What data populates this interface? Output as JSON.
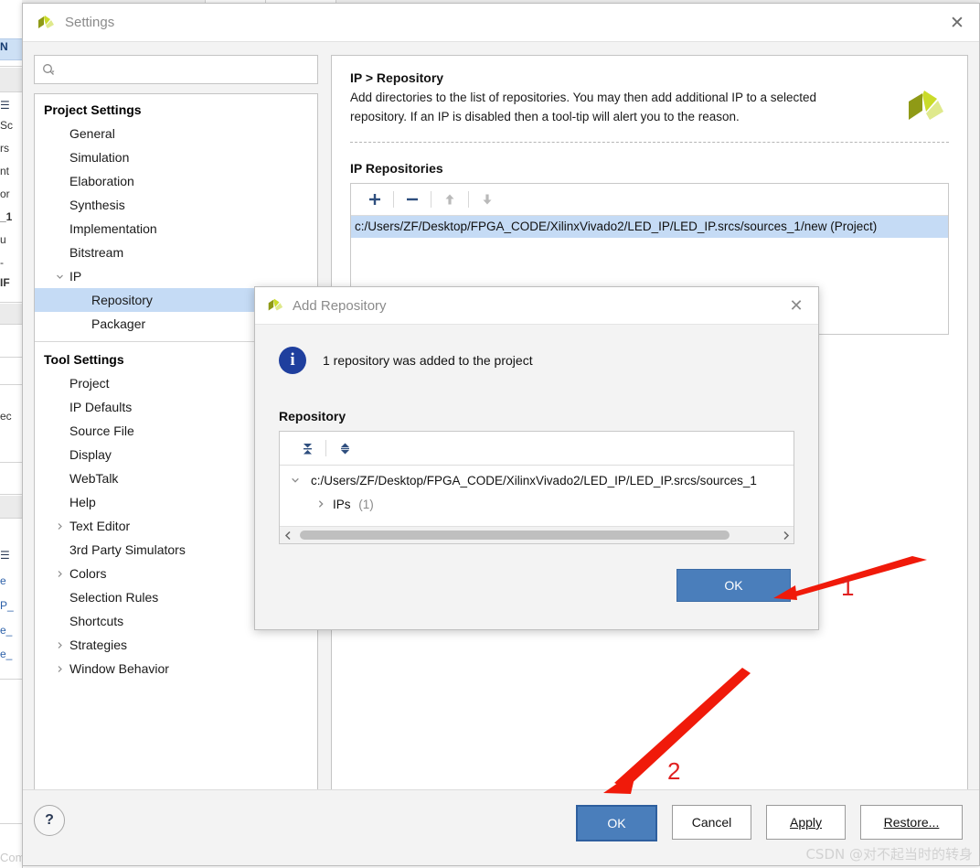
{
  "background": {
    "left_strip_labels": [
      "N",
      "Sc",
      "rs",
      "nt",
      "or",
      "_1",
      "u",
      "-",
      "IF",
      "ec",
      "e",
      "P_",
      "e_",
      "e_"
    ],
    "bottom_text": "Command here"
  },
  "window": {
    "title": "Settings",
    "close_icon": "close-icon",
    "logo_icon": "vivado-logo-icon"
  },
  "search": {
    "value": "",
    "placeholder": "",
    "icon": "search-icon"
  },
  "sidebar": {
    "groups": [
      {
        "label": "Project Settings",
        "items": [
          {
            "label": "General",
            "expandable": false,
            "selected": false,
            "child": false
          },
          {
            "label": "Simulation",
            "expandable": false,
            "selected": false,
            "child": false
          },
          {
            "label": "Elaboration",
            "expandable": false,
            "selected": false,
            "child": false
          },
          {
            "label": "Synthesis",
            "expandable": false,
            "selected": false,
            "child": false
          },
          {
            "label": "Implementation",
            "expandable": false,
            "selected": false,
            "child": false
          },
          {
            "label": "Bitstream",
            "expandable": false,
            "selected": false,
            "child": false
          },
          {
            "label": "IP",
            "expandable": true,
            "expanded": true,
            "selected": false,
            "child": false
          },
          {
            "label": "Repository",
            "expandable": false,
            "selected": true,
            "child": true
          },
          {
            "label": "Packager",
            "expandable": false,
            "selected": false,
            "child": true
          }
        ]
      },
      {
        "label": "Tool Settings",
        "items": [
          {
            "label": "Project",
            "expandable": false,
            "selected": false,
            "child": false
          },
          {
            "label": "IP Defaults",
            "expandable": false,
            "selected": false,
            "child": false
          },
          {
            "label": "Source File",
            "expandable": false,
            "selected": false,
            "child": false
          },
          {
            "label": "Display",
            "expandable": false,
            "selected": false,
            "child": false
          },
          {
            "label": "WebTalk",
            "expandable": false,
            "selected": false,
            "child": false
          },
          {
            "label": "Help",
            "expandable": false,
            "selected": false,
            "child": false
          },
          {
            "label": "Text Editor",
            "expandable": true,
            "expanded": false,
            "selected": false,
            "child": false
          },
          {
            "label": "3rd Party Simulators",
            "expandable": false,
            "selected": false,
            "child": false
          },
          {
            "label": "Colors",
            "expandable": true,
            "expanded": false,
            "selected": false,
            "child": false
          },
          {
            "label": "Selection Rules",
            "expandable": false,
            "selected": false,
            "child": false
          },
          {
            "label": "Shortcuts",
            "expandable": false,
            "selected": false,
            "child": false
          },
          {
            "label": "Strategies",
            "expandable": true,
            "expanded": false,
            "selected": false,
            "child": false
          },
          {
            "label": "Window Behavior",
            "expandable": true,
            "expanded": false,
            "selected": false,
            "child": false
          }
        ]
      }
    ]
  },
  "main": {
    "breadcrumb_title": "IP > Repository",
    "description": "Add directories to the list of repositories. You may then add additional IP to a selected repository. If an IP is disabled then a tool-tip will alert you to the reason.",
    "section_title": "IP Repositories",
    "toolbar": {
      "add_label": "+",
      "remove_label": "−",
      "move_up_icon": "arrow-up-icon",
      "move_down_icon": "arrow-down-icon"
    },
    "repositories": [
      "c:/Users/ZF/Desktop/FPGA_CODE/XilinxVivado2/LED_IP/LED_IP.srcs/sources_1/new (Project)"
    ]
  },
  "footer": {
    "help_label": "?",
    "buttons": [
      {
        "name": "ok",
        "label": "OK",
        "mnemonic": "",
        "primary": true
      },
      {
        "name": "cancel",
        "label": "Cancel",
        "mnemonic": "",
        "primary": false
      },
      {
        "name": "apply",
        "label": "Apply",
        "mnemonic": "A",
        "primary": false
      },
      {
        "name": "restore",
        "label": "Restore...",
        "mnemonic": "R",
        "primary": false
      }
    ]
  },
  "dialog": {
    "title": "Add Repository",
    "close_icon": "close-icon",
    "info_icon": "info-icon",
    "message": "1 repository was added to the project",
    "section_title": "Repository",
    "toolbar": {
      "collapse_all_icon": "collapse-all-icon",
      "expand_all_icon": "expand-collapse-icon"
    },
    "tree": [
      {
        "label": "c:/Users/ZF/Desktop/FPGA_CODE/XilinxVivado2/LED_IP/LED_IP.srcs/sources_1",
        "expanded": true,
        "indent": false,
        "count": ""
      },
      {
        "label": "IPs",
        "expanded": false,
        "indent": true,
        "count": "(1)"
      }
    ],
    "ok_label": "OK",
    "scroll_left_icon": "chevron-left-icon",
    "scroll_right_icon": "chevron-right-icon"
  },
  "annotations": {
    "markers": [
      {
        "number": "1",
        "color": "#e02020"
      },
      {
        "number": "2",
        "color": "#e02020"
      }
    ],
    "arrow_color": "#f01a0a"
  },
  "watermark": {
    "text": "CSDN @对不起当时的转身"
  },
  "colors": {
    "accent_blue": "#4a7ebb",
    "selection_blue": "#c5dbf5",
    "info_blue": "#1f3f9e",
    "logo_olive": "#8f9a16",
    "logo_lime": "#cadb2a",
    "annotation_red": "#f01a0a"
  }
}
